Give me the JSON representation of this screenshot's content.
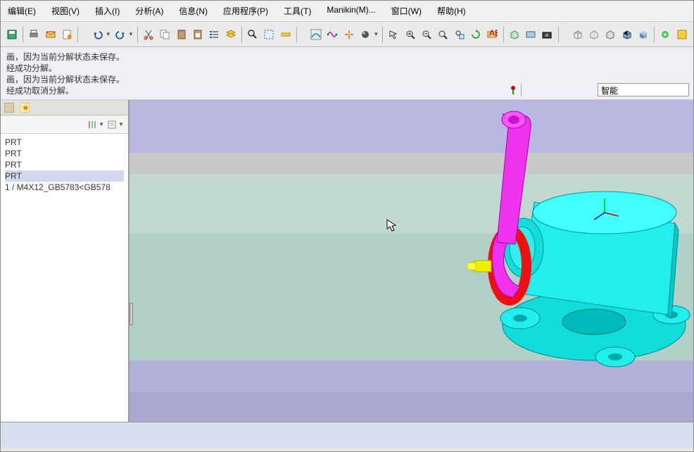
{
  "menu": {
    "edit": "编辑(E)",
    "view": "视图(V)",
    "insert": "插入(I)",
    "analysis": "分析(A)",
    "info": "信息(N)",
    "app": "应用程序(P)",
    "tools": "工具(T)",
    "manikin": "Manikin(M)...",
    "window": "窗口(W)",
    "help": "帮助(H)"
  },
  "messages": {
    "l1": "画，因为当前分解状态未保存。",
    "l2": "经成功分解。",
    "l3": "画，因为当前分解状态未保存。",
    "l4": "经成功取消分解。"
  },
  "smart_label": "智能",
  "tree": {
    "i1": "PRT",
    "i2": "PRT",
    "i3": "PRT",
    "i4": "PRT",
    "i5": "1 / M4X12_GB5783<GB578"
  }
}
